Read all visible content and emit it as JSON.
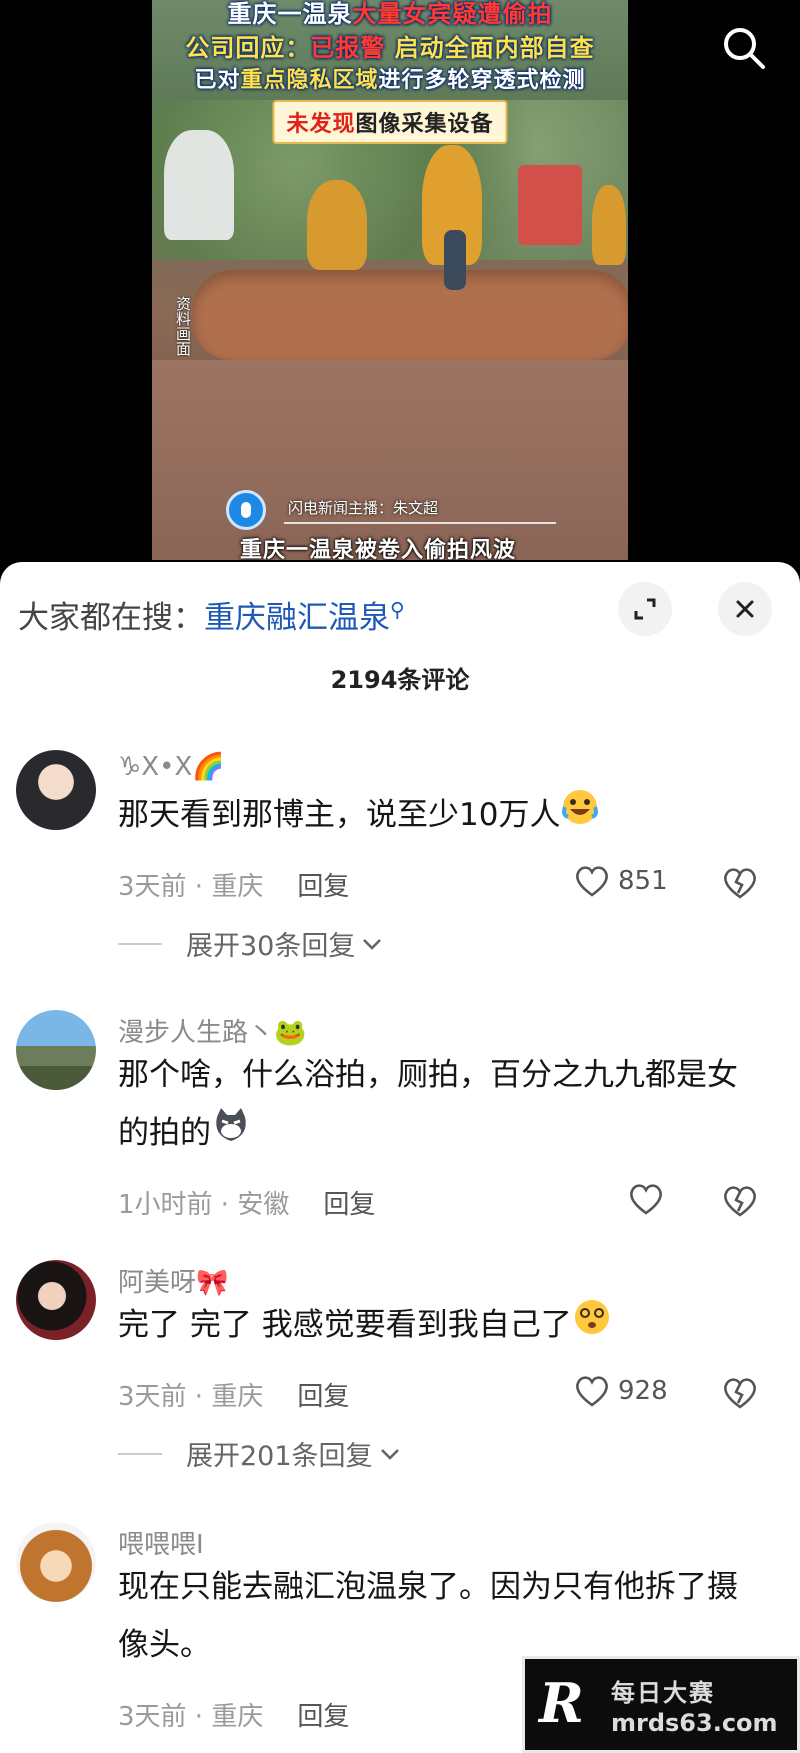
{
  "video": {
    "caption_line1_a": "重庆一温泉",
    "caption_line1_b": "大量女宾疑遭偷拍",
    "caption_line2_a": "公司回应：",
    "caption_line2_b": "已报警",
    "caption_line2_c": " 启动全面内部自查",
    "caption_line3_a": "已对",
    "caption_line3_b": "重点隐私区域",
    "caption_line3_c": "进行多轮穿透式检测",
    "caption_line4_a": "未发现",
    "caption_line4_b": "图像采集设备",
    "side_tag": "资料画面",
    "anchor": "闪电新闻主播：朱文超",
    "subtitle": "重庆一温泉被卷入偷拍风波"
  },
  "sheet": {
    "search_prefix": "大家都在搜：",
    "search_term": "重庆融汇温泉",
    "comment_count": "2194条评论"
  },
  "comments": [
    {
      "name": "♑X•X🌈",
      "text": "那天看到那博主，说至少10万人",
      "time_location": "3天前 · 重庆",
      "reply": "回复",
      "likes": "851",
      "expand": "展开30条回复"
    },
    {
      "name": "漫步人生路丶🐸",
      "text": "那个啥，什么浴拍，厕拍，百分之九九都是女的拍的",
      "time_location": "1小时前 · 安徽",
      "reply": "回复",
      "likes": ""
    },
    {
      "name": "阿美呀🎀",
      "text": "完了 完了 我感觉要看到我自己了",
      "time_location": "3天前 · 重庆",
      "reply": "回复",
      "likes": "928",
      "expand": "展开201条回复"
    },
    {
      "name": "喂喂喂I",
      "text": "现在只能去融汇泡温泉了。因为只有他拆了摄像头。",
      "time_location": "3天前 · 重庆",
      "reply": "回复"
    }
  ],
  "watermark": {
    "logo": "R",
    "title": "每日大赛",
    "url": "mrds63.com"
  },
  "colors": {
    "link_blue": "#1f59b6",
    "caption_red": "#ff3a2e",
    "caption_yellow": "#ffe14a"
  }
}
